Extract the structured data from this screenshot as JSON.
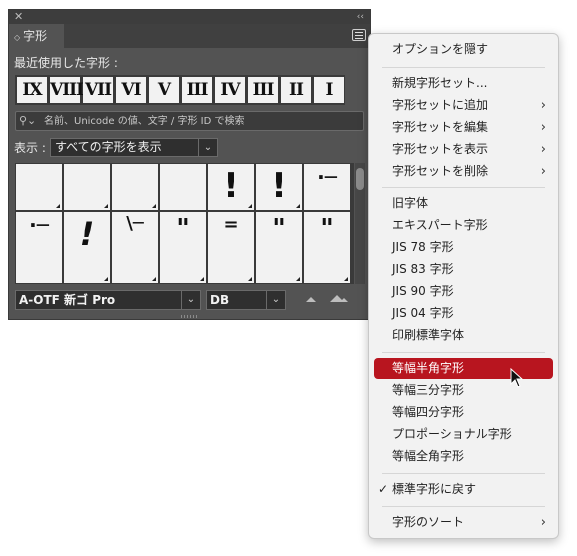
{
  "panel": {
    "tab_label": "字形",
    "recent_label": "最近使用した字形 :",
    "recent_glyphs": [
      "IX",
      "VIII",
      "VII",
      "VI",
      "V",
      "III",
      "IV",
      "III",
      "II",
      "I"
    ],
    "search_placeholder": "名前、Unicode の値、文字 / 字形 ID で検索",
    "show_label": "表示 :",
    "show_value": "すべての字形を表示",
    "grid_row1": [
      "",
      "",
      "",
      "",
      "!",
      "!",
      "·─"
    ],
    "grid_row2": [
      "·─",
      "!",
      "\\─",
      "\"",
      "=",
      "\"",
      "\""
    ],
    "font_family": "A-OTF 新ゴ Pro",
    "font_style": "DB"
  },
  "menu": {
    "items": [
      {
        "label": "オプションを隠す"
      },
      {
        "label": "新規字形セット..."
      },
      {
        "label": "字形セットに追加",
        "submenu": true
      },
      {
        "label": "字形セットを編集",
        "submenu": true
      },
      {
        "label": "字形セットを表示",
        "submenu": true
      },
      {
        "label": "字形セットを削除",
        "submenu": true
      },
      {
        "label": "旧字体"
      },
      {
        "label": "エキスパート字形"
      },
      {
        "label": "JIS 78 字形"
      },
      {
        "label": "JIS 83 字形"
      },
      {
        "label": "JIS 90 字形"
      },
      {
        "label": "JIS 04 字形"
      },
      {
        "label": "印刷標準字体"
      },
      {
        "label": "等幅半角字形",
        "highlighted": true
      },
      {
        "label": "等幅三分字形"
      },
      {
        "label": "等幅四分字形"
      },
      {
        "label": "プロポーショナル字形"
      },
      {
        "label": "等幅全角字形"
      },
      {
        "label": "標準字形に戻す",
        "checked": true
      },
      {
        "label": "字形のソート",
        "submenu": true
      }
    ]
  },
  "colors": {
    "panel_bg": "#535353",
    "highlight": "#b8151f",
    "menu_bg": "#f2f2f2"
  }
}
